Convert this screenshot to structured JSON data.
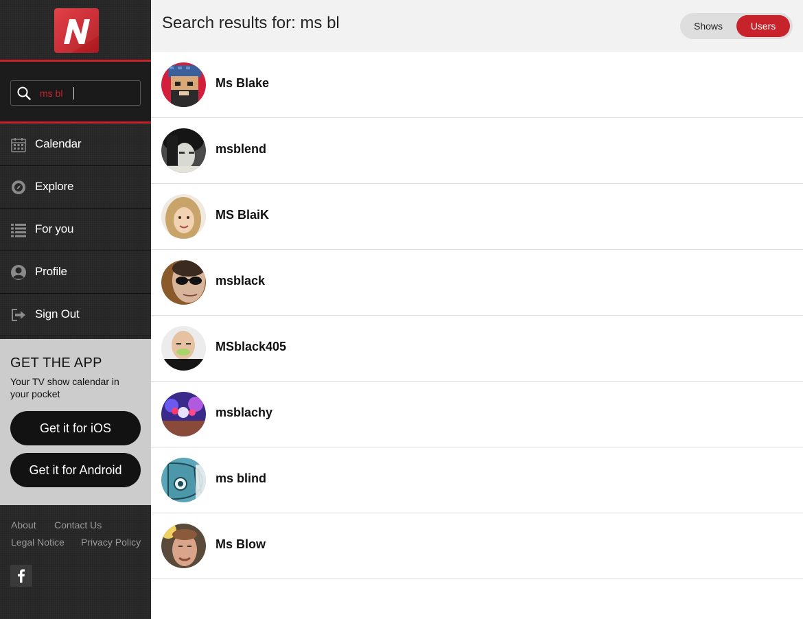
{
  "app": {
    "logo_letter": "N",
    "brand_color": "#c8232b"
  },
  "search": {
    "value": "ms bl"
  },
  "nav": [
    {
      "label": "Calendar",
      "icon": "calendar-icon"
    },
    {
      "label": "Explore",
      "icon": "compass-icon"
    },
    {
      "label": "For you",
      "icon": "list-icon"
    },
    {
      "label": "Profile",
      "icon": "user-icon"
    },
    {
      "label": "Sign Out",
      "icon": "sign-out-icon"
    }
  ],
  "get_app": {
    "title": "GET THE APP",
    "subtitle": "Your TV show calendar in your pocket",
    "ios_label": "Get it for iOS",
    "android_label": "Get it for Android"
  },
  "footer": {
    "about": "About",
    "contact": "Contact Us",
    "legal": "Legal Notice",
    "privacy": "Privacy Policy",
    "facebook_icon": "facebook-icon"
  },
  "header": {
    "title": "Search results for: ms bl",
    "tabs": [
      "Shows",
      "Users"
    ],
    "active_tab": "Users"
  },
  "results": [
    {
      "name": "Ms Blake"
    },
    {
      "name": "msblend"
    },
    {
      "name": "MS BlaiK"
    },
    {
      "name": "msblack"
    },
    {
      "name": "MSblack405"
    },
    {
      "name": "msblachy"
    },
    {
      "name": "ms blind"
    },
    {
      "name": "Ms Blow"
    }
  ]
}
